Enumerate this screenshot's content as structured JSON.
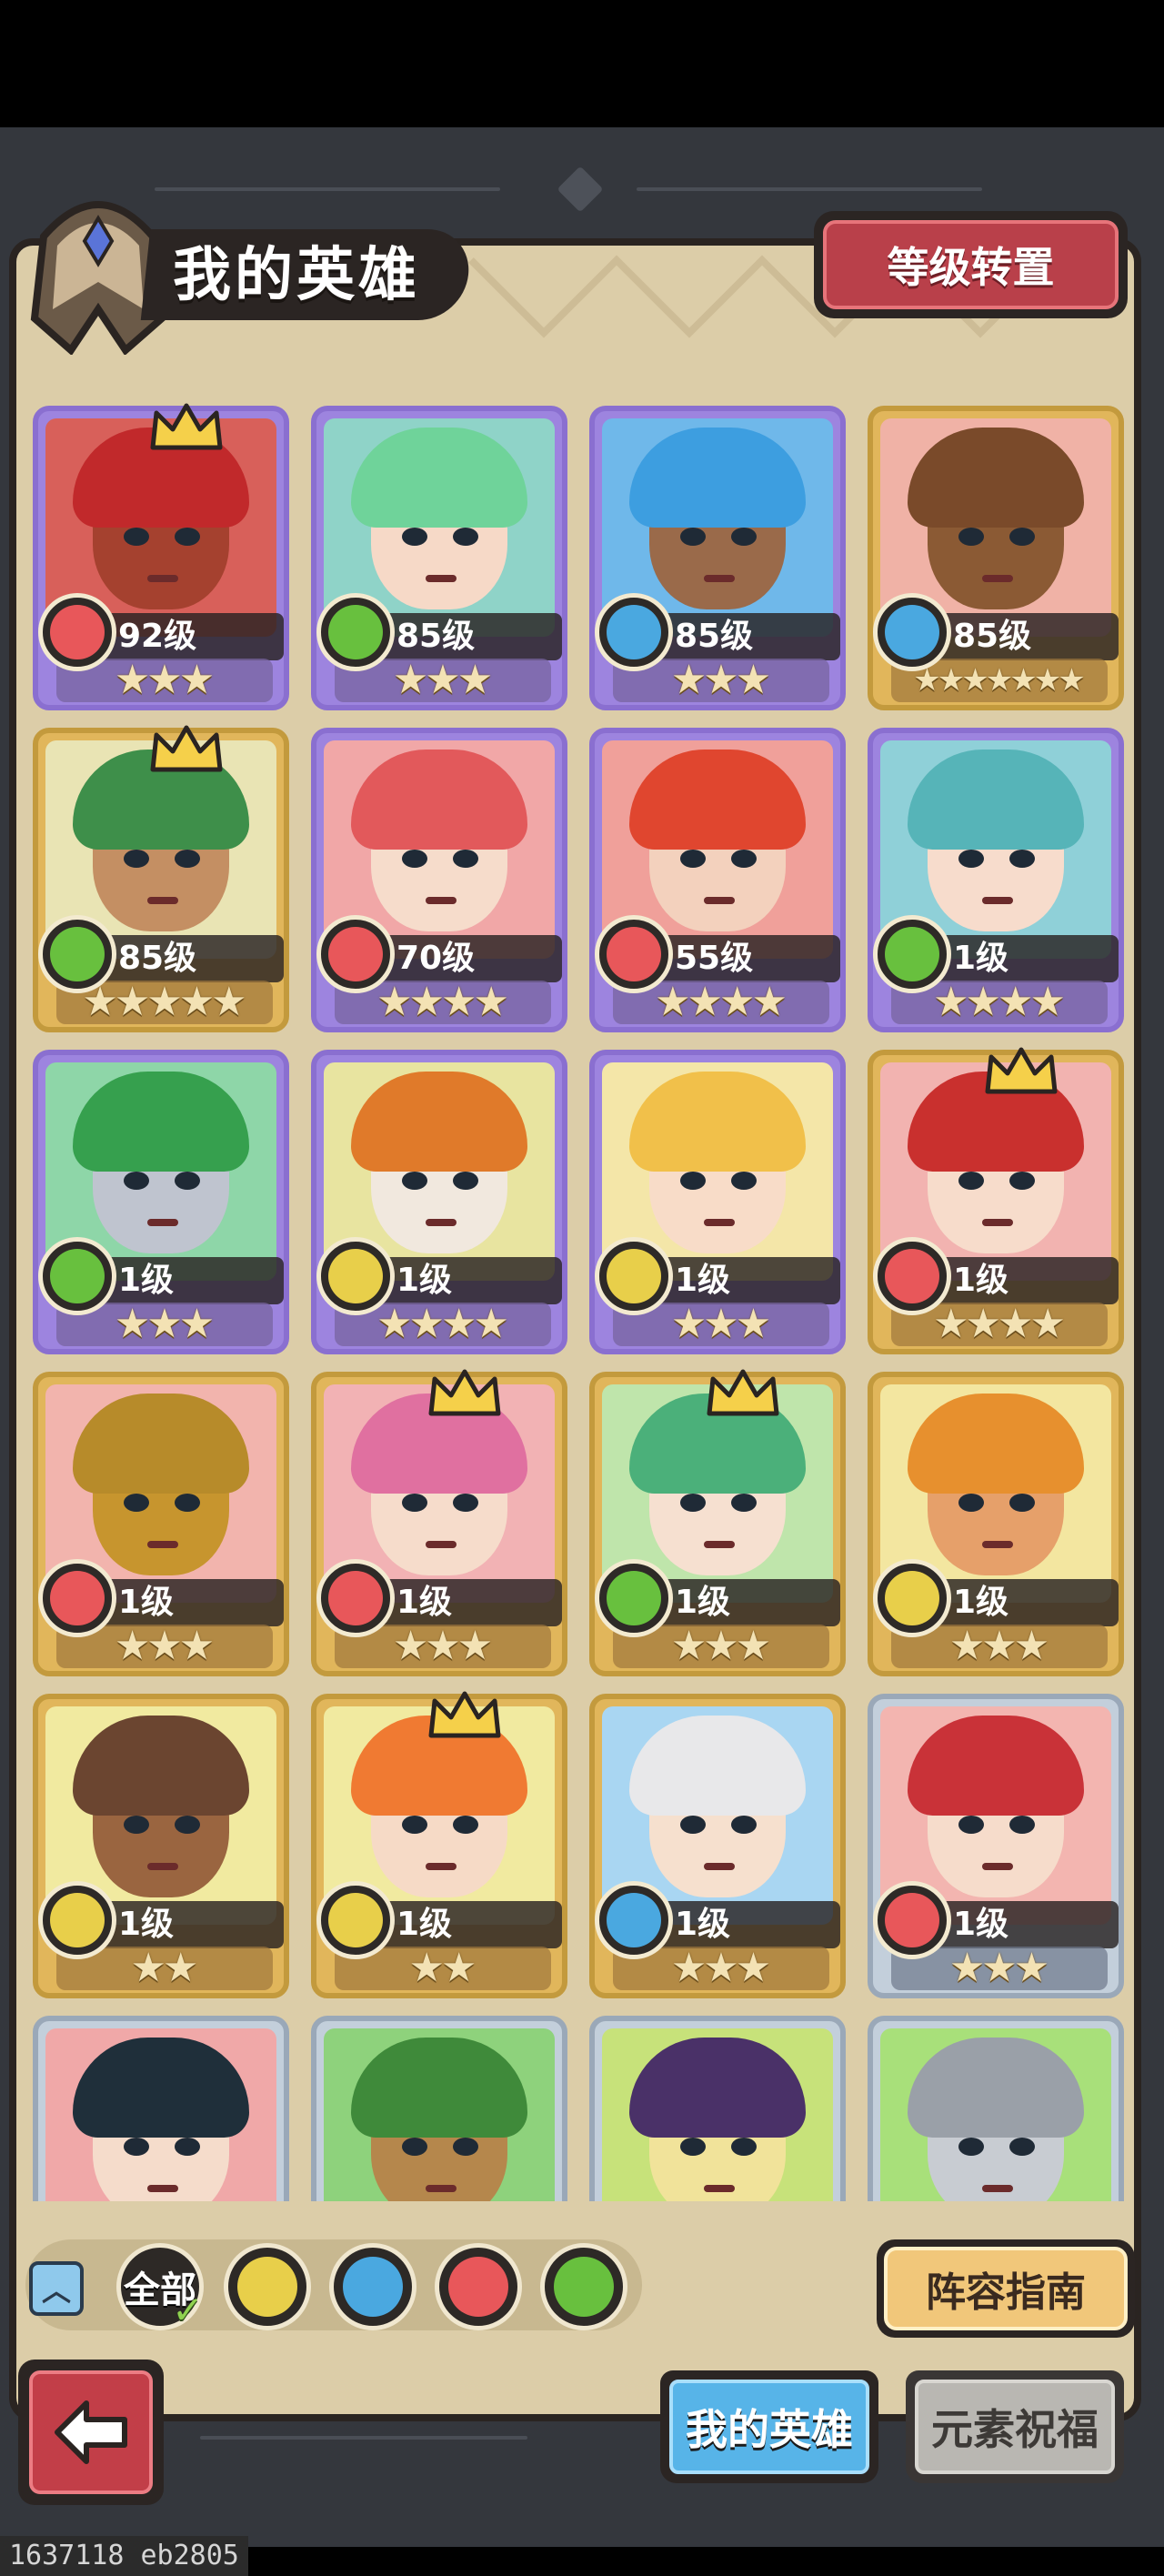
{
  "header": {
    "title": "我的英雄",
    "level_transfer_label": "等级转置"
  },
  "element_colors": {
    "fire": "#e8575a",
    "wind": "#68c03e",
    "water": "#4aa8e0",
    "earth": "#e8cf4a"
  },
  "heroes": [
    {
      "level": "92级",
      "element": "fire",
      "stars": 3,
      "frame": "purple",
      "crown": true,
      "bg": "#d8605a",
      "skin": "#a5412f",
      "hair": "#c1292b"
    },
    {
      "level": "85级",
      "element": "wind",
      "stars": 3,
      "frame": "purple",
      "crown": false,
      "bg": "#8fd3c8",
      "skin": "#f6d9c7",
      "hair": "#6fd39a"
    },
    {
      "level": "85级",
      "element": "water",
      "stars": 3,
      "frame": "purple",
      "crown": false,
      "bg": "#6fb8ea",
      "skin": "#9a6a4a",
      "hair": "#3d9ee0"
    },
    {
      "level": "85级",
      "element": "water",
      "stars": 7,
      "frame": "gold",
      "crown": false,
      "bg": "#f0b2a6",
      "skin": "#8b5a34",
      "hair": "#7a4a2a"
    },
    {
      "level": "85级",
      "element": "wind",
      "stars": 5,
      "frame": "gold",
      "crown": true,
      "bg": "#e9e4b4",
      "skin": "#c48f63",
      "hair": "#3e8f4a"
    },
    {
      "level": "70级",
      "element": "fire",
      "stars": 4,
      "frame": "purple",
      "crown": false,
      "bg": "#f1a7a7",
      "skin": "#f6dccb",
      "hair": "#e2595b"
    },
    {
      "level": "55级",
      "element": "fire",
      "stars": 4,
      "frame": "purple",
      "crown": false,
      "bg": "#f0a09a",
      "skin": "#f3d1bd",
      "hair": "#e0462f"
    },
    {
      "level": "1级",
      "element": "wind",
      "stars": 4,
      "frame": "purple",
      "crown": false,
      "bg": "#8fd0d8",
      "skin": "#f7dccc",
      "hair": "#56b4b8"
    },
    {
      "level": "1级",
      "element": "wind",
      "stars": 3,
      "frame": "purple",
      "crown": false,
      "bg": "#8ed6a8",
      "skin": "#bfc4cf",
      "hair": "#36a04e"
    },
    {
      "level": "1级",
      "element": "earth",
      "stars": 4,
      "frame": "purple",
      "crown": false,
      "bg": "#e8e4a0",
      "skin": "#f1e8de",
      "hair": "#e07a2a"
    },
    {
      "level": "1级",
      "element": "earth",
      "stars": 3,
      "frame": "purple",
      "crown": false,
      "bg": "#f4e6a8",
      "skin": "#f8dcc8",
      "hair": "#f1c04a"
    },
    {
      "level": "1级",
      "element": "fire",
      "stars": 4,
      "frame": "gold",
      "crown": true,
      "bg": "#f2b3b0",
      "skin": "#f7dccb",
      "hair": "#c9302e"
    },
    {
      "level": "1级",
      "element": "fire",
      "stars": 3,
      "frame": "gold",
      "crown": false,
      "bg": "#f2b4ad",
      "skin": "#c7952e",
      "hair": "#b78b2a"
    },
    {
      "level": "1级",
      "element": "fire",
      "stars": 3,
      "frame": "gold",
      "crown": true,
      "bg": "#f2b2b4",
      "skin": "#f6dccb",
      "hair": "#e070a0"
    },
    {
      "level": "1级",
      "element": "wind",
      "stars": 3,
      "frame": "gold",
      "crown": true,
      "bg": "#bfe5ab",
      "skin": "#f6e0d0",
      "hair": "#4bb07a"
    },
    {
      "level": "1级",
      "element": "earth",
      "stars": 3,
      "frame": "gold",
      "crown": false,
      "bg": "#f3e6a0",
      "skin": "#e6a06a",
      "hair": "#e7902e"
    },
    {
      "level": "1级",
      "element": "earth",
      "stars": 2,
      "frame": "gold",
      "crown": false,
      "bg": "#f1eaa0",
      "skin": "#9a6540",
      "hair": "#6b4530"
    },
    {
      "level": "1级",
      "element": "earth",
      "stars": 2,
      "frame": "gold",
      "crown": true,
      "bg": "#f1eaa0",
      "skin": "#f6dac6",
      "hair": "#f07a32"
    },
    {
      "level": "1级",
      "element": "water",
      "stars": 3,
      "frame": "gold",
      "crown": false,
      "bg": "#a9d6f2",
      "skin": "#f6e0ce",
      "hair": "#e8e8ea"
    },
    {
      "level": "1级",
      "element": "fire",
      "stars": 3,
      "frame": "silver",
      "crown": false,
      "bg": "#f3b5b0",
      "skin": "#f6dccb",
      "hair": "#c93238"
    },
    {
      "level": "",
      "element": "",
      "stars": 0,
      "frame": "silver",
      "crown": false,
      "bg": "#f0a8a8",
      "skin": "#f5dccb",
      "hair": "#1f2f3a"
    },
    {
      "level": "",
      "element": "",
      "stars": 0,
      "frame": "silver",
      "crown": false,
      "bg": "#8ed27c",
      "skin": "#b5874c",
      "hair": "#3f8a3a"
    },
    {
      "level": "",
      "element": "",
      "stars": 0,
      "frame": "silver",
      "crown": false,
      "bg": "#c7e27a",
      "skin": "#f1e39a",
      "hair": "#4a3168"
    },
    {
      "level": "",
      "element": "",
      "stars": 0,
      "frame": "silver",
      "crown": false,
      "bg": "#a8e07a",
      "skin": "#c8ccd2",
      "hair": "#9aa0a8"
    }
  ],
  "filters": {
    "all_label": "全部",
    "elements": [
      "earth",
      "water",
      "fire",
      "wind"
    ],
    "selected": "all"
  },
  "lineup_guide_label": "阵容指南",
  "tabs": {
    "my_heroes": "我的英雄",
    "element_blessing": "元素祝福"
  },
  "footer": {
    "build_text": "1637118 eb2805"
  }
}
